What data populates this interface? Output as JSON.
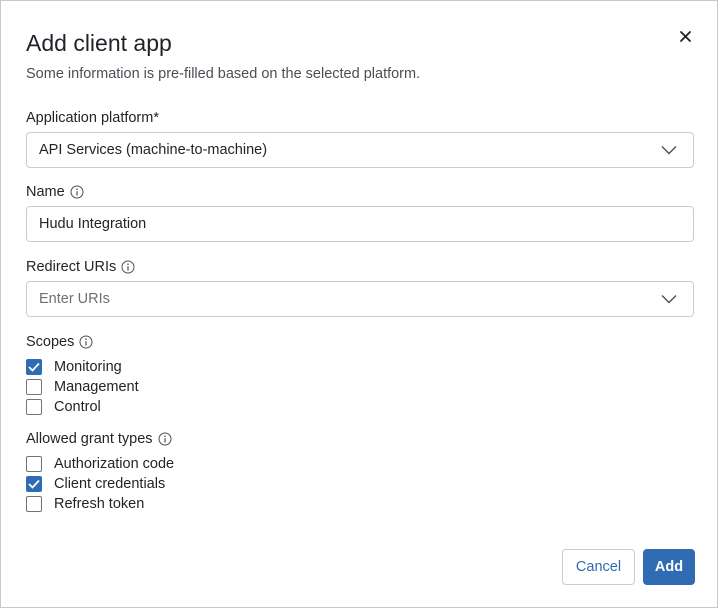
{
  "dialog": {
    "title": "Add client app",
    "subtitle": "Some information is pre-filled based on the selected platform.",
    "close_icon": "close-icon"
  },
  "platform": {
    "label": "Application platform*",
    "value": "API Services (machine-to-machine)"
  },
  "name": {
    "label": "Name",
    "value": "Hudu Integration"
  },
  "redirect": {
    "label": "Redirect URIs",
    "placeholder": "Enter URIs"
  },
  "scopes": {
    "label": "Scopes",
    "items": [
      {
        "label": "Monitoring",
        "checked": true
      },
      {
        "label": "Management",
        "checked": false
      },
      {
        "label": "Control",
        "checked": false
      }
    ]
  },
  "grants": {
    "label": "Allowed grant types",
    "items": [
      {
        "label": "Authorization code",
        "checked": false
      },
      {
        "label": "Client credentials",
        "checked": true
      },
      {
        "label": "Refresh token",
        "checked": false
      }
    ]
  },
  "footer": {
    "cancel_label": "Cancel",
    "add_label": "Add"
  },
  "colors": {
    "accent": "#2f6cb3",
    "border": "#c9ccd0"
  }
}
